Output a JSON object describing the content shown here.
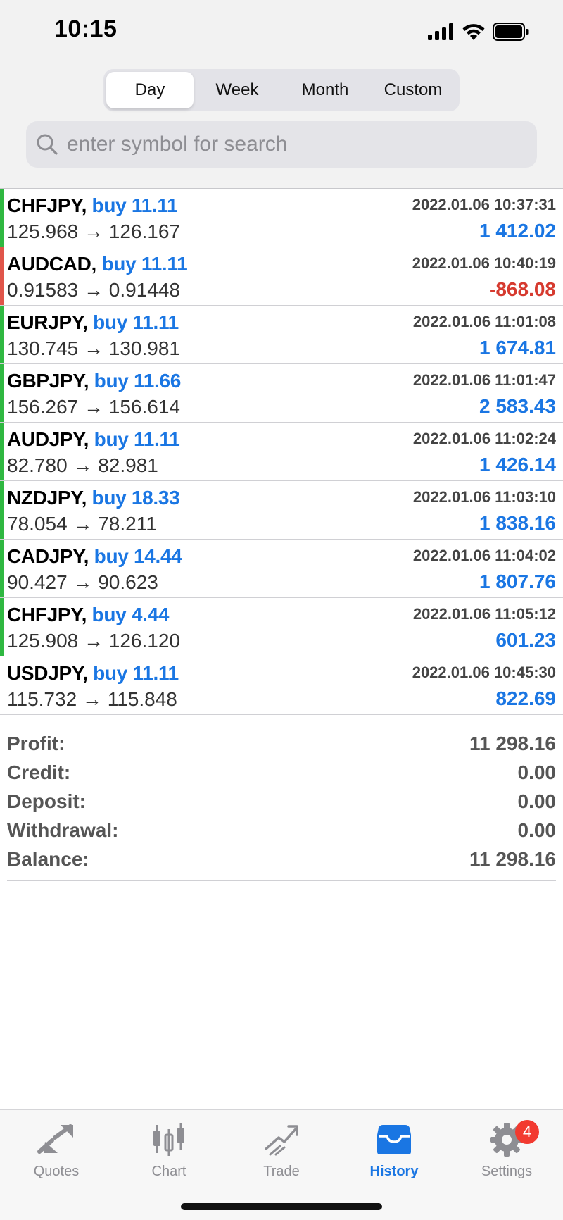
{
  "status_bar": {
    "time": "10:15"
  },
  "period_tabs": [
    {
      "label": "Day",
      "active": true
    },
    {
      "label": "Week",
      "active": false
    },
    {
      "label": "Month",
      "active": false
    },
    {
      "label": "Custom",
      "active": false
    }
  ],
  "search": {
    "placeholder": "enter symbol for search",
    "value": ""
  },
  "colors": {
    "accent": "#1a76e3",
    "profit_bar": "#2fb841",
    "loss_bar": "#e0554a",
    "loss_text": "#d63a2f",
    "badge": "#f23a30"
  },
  "trades": [
    {
      "symbol": "CHFJPY,",
      "side_volume": "buy 11.11",
      "datetime": "2022.01.06 10:37:31",
      "prices": "125.968 → 126.167",
      "profit": "1 412.02",
      "type": "profit"
    },
    {
      "symbol": "AUDCAD,",
      "side_volume": "buy 11.11",
      "datetime": "2022.01.06 10:40:19",
      "prices": "0.91583 → 0.91448",
      "profit": "-868.08",
      "type": "loss"
    },
    {
      "symbol": "EURJPY,",
      "side_volume": "buy 11.11",
      "datetime": "2022.01.06 11:01:08",
      "prices": "130.745 → 130.981",
      "profit": "1 674.81",
      "type": "profit"
    },
    {
      "symbol": "GBPJPY,",
      "side_volume": "buy 11.66",
      "datetime": "2022.01.06 11:01:47",
      "prices": "156.267 → 156.614",
      "profit": "2 583.43",
      "type": "profit"
    },
    {
      "symbol": "AUDJPY,",
      "side_volume": "buy 11.11",
      "datetime": "2022.01.06 11:02:24",
      "prices": "82.780 → 82.981",
      "profit": "1 426.14",
      "type": "profit"
    },
    {
      "symbol": "NZDJPY,",
      "side_volume": "buy 18.33",
      "datetime": "2022.01.06 11:03:10",
      "prices": "78.054 → 78.211",
      "profit": "1 838.16",
      "type": "profit"
    },
    {
      "symbol": "CADJPY,",
      "side_volume": "buy 14.44",
      "datetime": "2022.01.06 11:04:02",
      "prices": "90.427 → 90.623",
      "profit": "1 807.76",
      "type": "profit"
    },
    {
      "symbol": "CHFJPY,",
      "side_volume": "buy 4.44",
      "datetime": "2022.01.06 11:05:12",
      "prices": "125.908 → 126.120",
      "profit": "601.23",
      "type": "profit"
    },
    {
      "symbol": "USDJPY,",
      "side_volume": "buy 11.11",
      "datetime": "2022.01.06 10:45:30",
      "prices": "115.732 → 115.848",
      "profit": "822.69",
      "type": "none"
    }
  ],
  "summary": [
    {
      "label": "Profit:",
      "value": "11 298.16"
    },
    {
      "label": "Credit:",
      "value": "0.00"
    },
    {
      "label": "Deposit:",
      "value": "0.00"
    },
    {
      "label": "Withdrawal:",
      "value": "0.00"
    },
    {
      "label": "Balance:",
      "value": "11 298.16"
    }
  ],
  "tabbar": [
    {
      "label": "Quotes",
      "icon": "quotes-icon",
      "active": false
    },
    {
      "label": "Chart",
      "icon": "chart-icon",
      "active": false
    },
    {
      "label": "Trade",
      "icon": "trade-icon",
      "active": false
    },
    {
      "label": "History",
      "icon": "history-icon",
      "active": true
    },
    {
      "label": "Settings",
      "icon": "gear-icon",
      "active": false,
      "badge": "4"
    }
  ]
}
